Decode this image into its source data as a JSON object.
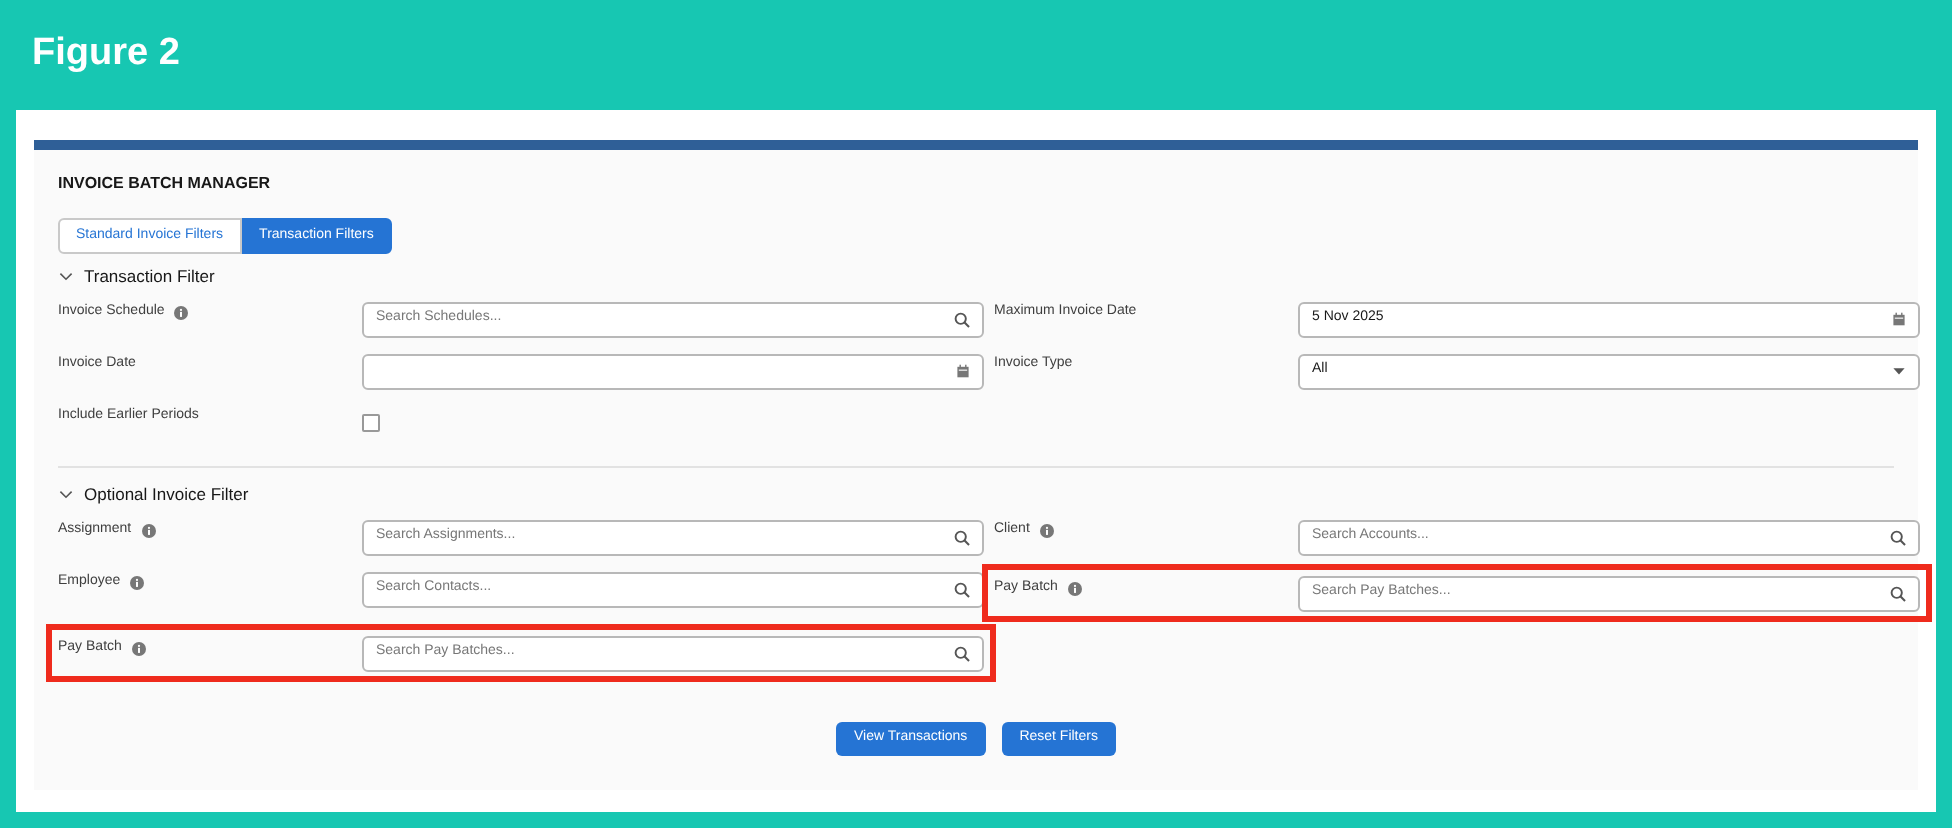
{
  "figure_title": "Figure 2",
  "app": {
    "title": "INVOICE BATCH MANAGER"
  },
  "tabs": [
    {
      "label": "Standard Invoice Filters",
      "selected": false
    },
    {
      "label": "Transaction Filters",
      "selected": true
    }
  ],
  "sections": [
    {
      "title": "Transaction Filter",
      "expanded": true,
      "left": [
        {
          "label": "Invoice Schedule",
          "info": true,
          "kind": "search",
          "placeholder": "Search Schedules...",
          "highlighted": false
        },
        {
          "label": "Invoice Date",
          "info": false,
          "kind": "date",
          "highlighted": false
        },
        {
          "label": "Include Earlier Periods",
          "info": false,
          "kind": "checkbox",
          "checked": false,
          "highlighted": false
        }
      ],
      "right": [
        {
          "label": "Maximum Invoice Date",
          "info": false,
          "kind": "date",
          "value": "5 Nov 2025",
          "highlighted": false
        },
        {
          "label": "Invoice Type",
          "info": false,
          "kind": "select",
          "value": "All",
          "highlighted": false
        }
      ]
    },
    {
      "title": "Optional Invoice Filter",
      "expanded": true,
      "left": [
        {
          "label": "Assignment",
          "info": true,
          "kind": "search",
          "placeholder": "Search Assignments...",
          "highlighted": false
        },
        {
          "label": "Employee",
          "info": true,
          "kind": "search",
          "placeholder": "Search Contacts...",
          "highlighted": false
        },
        {
          "label": "Pay Batch",
          "info": true,
          "kind": "search",
          "placeholder": "Search Pay Batches...",
          "highlighted": true
        }
      ],
      "right": [
        {
          "label": "Client",
          "info": true,
          "kind": "search",
          "placeholder": "Search Accounts...",
          "highlighted": false
        },
        {
          "label": "Pay Batch",
          "info": true,
          "kind": "search",
          "placeholder": "Search Pay Batches...",
          "highlighted": true
        }
      ]
    }
  ],
  "buttons": [
    "View Transactions",
    "Reset Filters"
  ]
}
